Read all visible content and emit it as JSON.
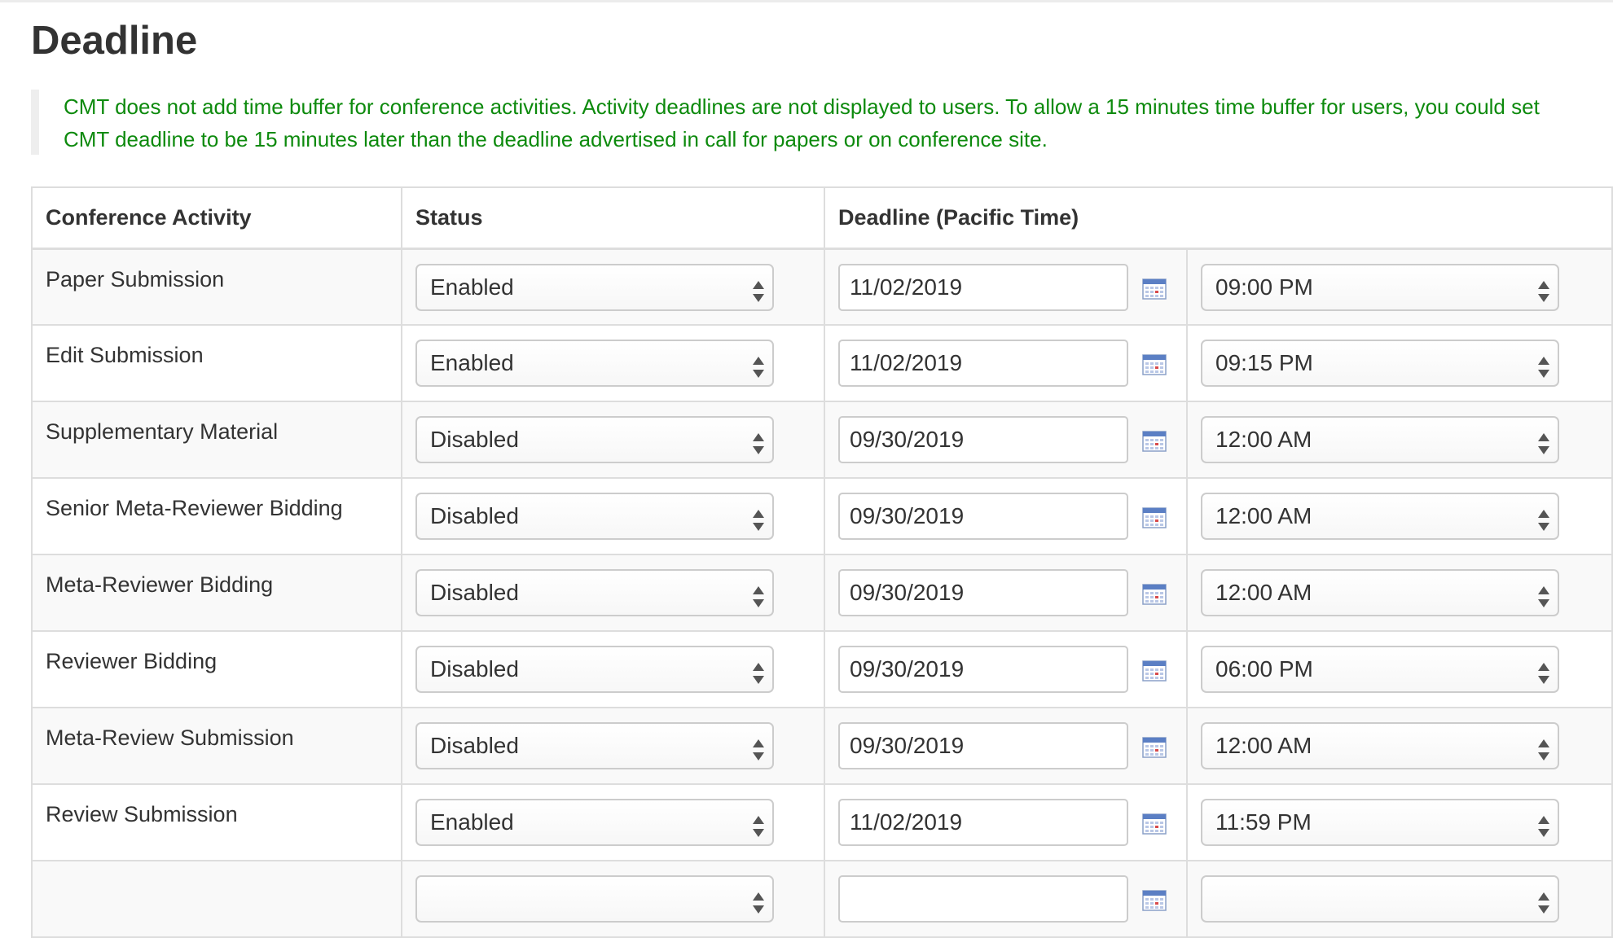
{
  "page": {
    "title": "Deadline",
    "notice": "CMT does not add time buffer for conference activities. Activity deadlines are not displayed to users. To allow a 15 minutes time buffer for users, you could set CMT deadline to be 15 minutes later than the deadline advertised in call for papers or on conference site."
  },
  "colors": {
    "notice_text": "#0d8a0d",
    "notice_border": "#eeeeee",
    "table_border": "#dddddd",
    "stripe_row": "#f9f9f9"
  },
  "table": {
    "headers": {
      "activity": "Conference Activity",
      "status": "Status",
      "deadline": "Deadline (Pacific Time)"
    },
    "rows": [
      {
        "activity": "Paper Submission",
        "status": "Enabled",
        "date": "11/02/2019",
        "time": "09:00 PM"
      },
      {
        "activity": "Edit Submission",
        "status": "Enabled",
        "date": "11/02/2019",
        "time": "09:15 PM"
      },
      {
        "activity": "Supplementary Material",
        "status": "Disabled",
        "date": "09/30/2019",
        "time": "12:00 AM"
      },
      {
        "activity": "Senior Meta-Reviewer Bidding",
        "status": "Disabled",
        "date": "09/30/2019",
        "time": "12:00 AM"
      },
      {
        "activity": "Meta-Reviewer Bidding",
        "status": "Disabled",
        "date": "09/30/2019",
        "time": "12:00 AM"
      },
      {
        "activity": "Reviewer Bidding",
        "status": "Disabled",
        "date": "09/30/2019",
        "time": "06:00 PM"
      },
      {
        "activity": "Meta-Review Submission",
        "status": "Disabled",
        "date": "09/30/2019",
        "time": "12:00 AM"
      },
      {
        "activity": "Review Submission",
        "status": "Enabled",
        "date": "11/02/2019",
        "time": "11:59 PM"
      },
      {
        "activity": "",
        "status": "",
        "date": "",
        "time": ""
      }
    ]
  },
  "icons": {
    "calendar": "calendar-icon",
    "select_arrows": "up-down-arrows-icon"
  }
}
